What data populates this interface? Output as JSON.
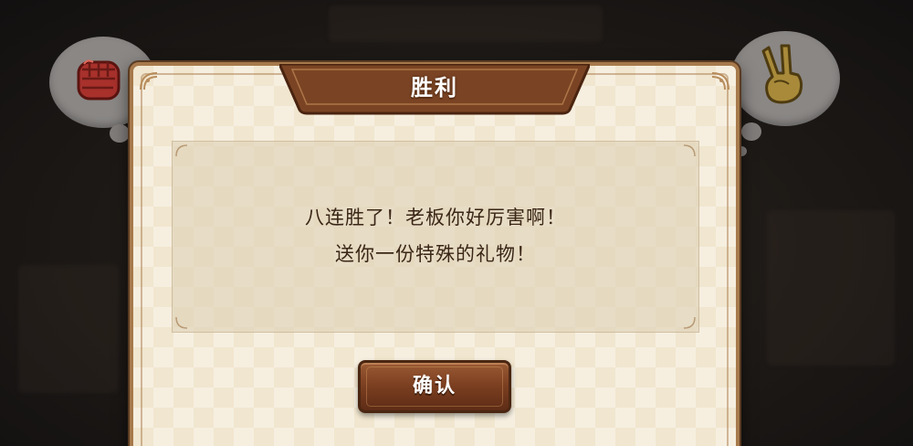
{
  "dialog": {
    "title": "胜利",
    "message_line_1": "八连胜了！老板你好厉害啊！",
    "message_line_2": "送你一份特殊的礼物！",
    "confirm_label": "确认"
  },
  "icons": {
    "left_bubble": "fist-icon",
    "right_bubble": "victory-hand-icon"
  },
  "colors": {
    "dialog_bg": "#f1e6cf",
    "dialog_border": "#a77a4c",
    "ribbon": "#7a4424",
    "button": "#7a3e20",
    "fist": "#a8312c",
    "victory_hand": "#a88a3a",
    "message_text": "#3a2616"
  }
}
